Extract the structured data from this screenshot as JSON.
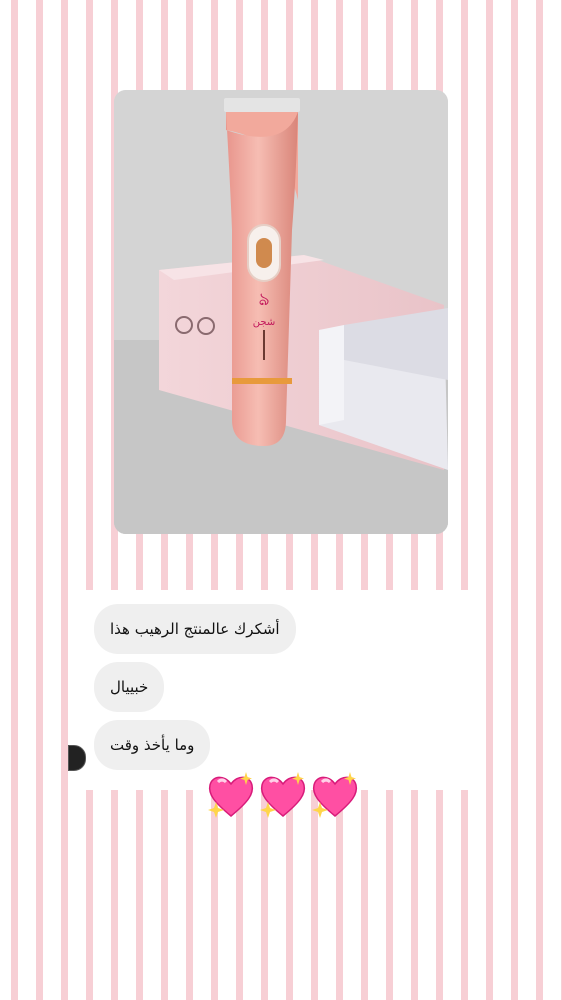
{
  "story": {
    "photo": {
      "description_icon": "pink-hair-trimmer-photo",
      "brand_glyph": "شجن"
    },
    "messages": [
      {
        "text": "أشكرك عالمنتج الرهيب هذا"
      },
      {
        "text": "خبييال"
      },
      {
        "text": "وما يأخذ وقت"
      }
    ],
    "reaction_emojis": [
      "sparkling-heart-icon",
      "sparkling-heart-icon",
      "sparkling-heart-icon"
    ],
    "colors": {
      "stripe_pink": "#f7cfd5",
      "bubble_gray": "#efefef",
      "trimmer_pink": "#f3b6ac",
      "heart_pink": "#ff4fa3"
    }
  }
}
